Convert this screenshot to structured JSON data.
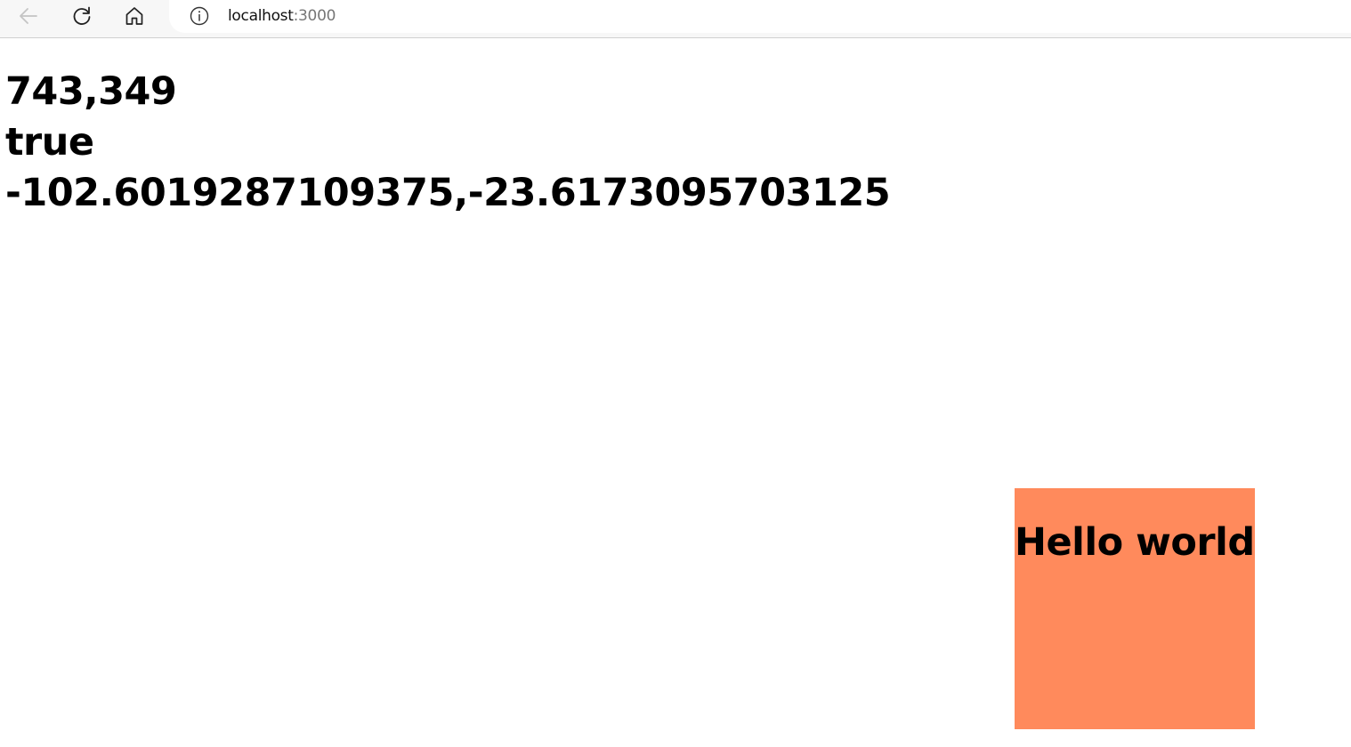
{
  "browser": {
    "back_icon": "arrow-left-icon",
    "reload_icon": "reload-icon",
    "home_icon": "home-icon",
    "site_info_icon": "info-icon",
    "url_host": "localhost",
    "url_port": ":3000"
  },
  "content": {
    "line1": "743,349",
    "line2": "true",
    "line3": "-102.6019287109375,-23.6173095703125"
  },
  "box": {
    "title": "Hello world",
    "color": "#ff8a5c"
  }
}
